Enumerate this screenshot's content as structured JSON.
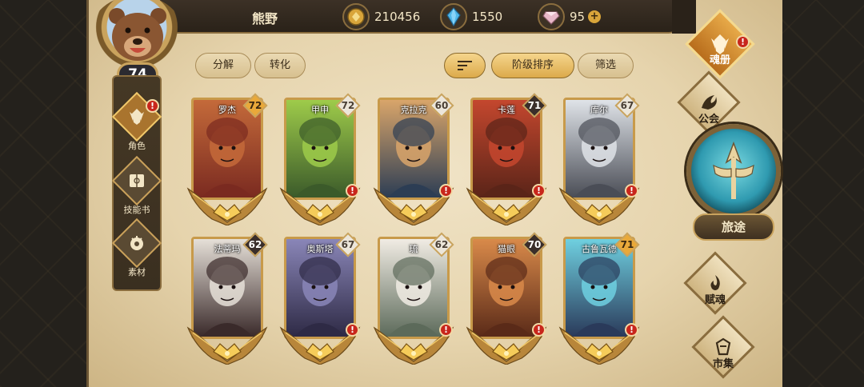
{
  "player": {
    "name": "熊野",
    "level": "74",
    "avatar_icon": "bear-avatar-icon"
  },
  "currencies": [
    {
      "icon": "gold-coin-icon",
      "value": "210456"
    },
    {
      "icon": "blue-crystal-icon",
      "value": "1550"
    },
    {
      "icon": "pink-gem-icon",
      "value": "95",
      "plus": "+"
    }
  ],
  "left_menu": [
    {
      "label": "角色",
      "icon": "character-icon",
      "active": true,
      "alert": "!"
    },
    {
      "label": "技能书",
      "icon": "skill-book-icon",
      "active": false
    },
    {
      "label": "素材",
      "icon": "material-icon",
      "active": false
    }
  ],
  "toolbar": {
    "decompose": "分解",
    "convert": "转化",
    "sort_icon": "sort-lines-icon",
    "sort_by_rank": "阶级排序",
    "filter": "筛选"
  },
  "heroes": [
    {
      "name": "罗杰",
      "level": "72",
      "tag": "gold",
      "alert": "",
      "palette": [
        "#7a2a20",
        "#c46a3a"
      ]
    },
    {
      "name": "甲申",
      "level": "72",
      "tag": "white",
      "alert": "!",
      "palette": [
        "#3b5a2a",
        "#9ecb4a"
      ]
    },
    {
      "name": "克拉克",
      "level": "60",
      "tag": "white",
      "alert": "!",
      "palette": [
        "#2c3d54",
        "#d9a56a"
      ]
    },
    {
      "name": "卡莲",
      "level": "71",
      "tag": "dark",
      "alert": "!",
      "palette": [
        "#5a2418",
        "#c4472e"
      ]
    },
    {
      "name": "库尔",
      "level": "67",
      "tag": "white",
      "alert": "!",
      "palette": [
        "#4a4d56",
        "#dfe3e8"
      ]
    },
    {
      "name": "法蒂玛",
      "level": "62",
      "tag": "dark",
      "alert": "",
      "palette": [
        "#3a2a2a",
        "#e6e0d8"
      ]
    },
    {
      "name": "奥斯塔",
      "level": "67",
      "tag": "white",
      "alert": "!",
      "palette": [
        "#2e2a45",
        "#8a86b8"
      ]
    },
    {
      "name": "琉",
      "level": "62",
      "tag": "white",
      "alert": "!",
      "palette": [
        "#5c6a5a",
        "#f1ece4"
      ]
    },
    {
      "name": "猫眼",
      "level": "70",
      "tag": "dark",
      "alert": "!",
      "palette": [
        "#5a2a18",
        "#d98a4a"
      ]
    },
    {
      "name": "古鲁瓦德",
      "level": "71",
      "tag": "gold",
      "alert": "!",
      "palette": [
        "#2a3a5a",
        "#6fd0e0"
      ]
    }
  ],
  "right_menu": [
    {
      "label": "魂册",
      "icon": "soul-book-icon",
      "active": true,
      "alert": "!"
    },
    {
      "label": "公会",
      "icon": "guild-icon",
      "active": false
    },
    {
      "label": "旅途",
      "icon": "journey-icon",
      "active": false
    },
    {
      "label": "赋魂",
      "icon": "soul-infuse-icon",
      "active": false
    },
    {
      "label": "市集",
      "icon": "market-icon",
      "active": false
    }
  ],
  "colors": {
    "gold": "#f0b84a",
    "alert_red": "#c8261c",
    "parchment": "#e6d4ad",
    "frame": "#c89a4a"
  }
}
